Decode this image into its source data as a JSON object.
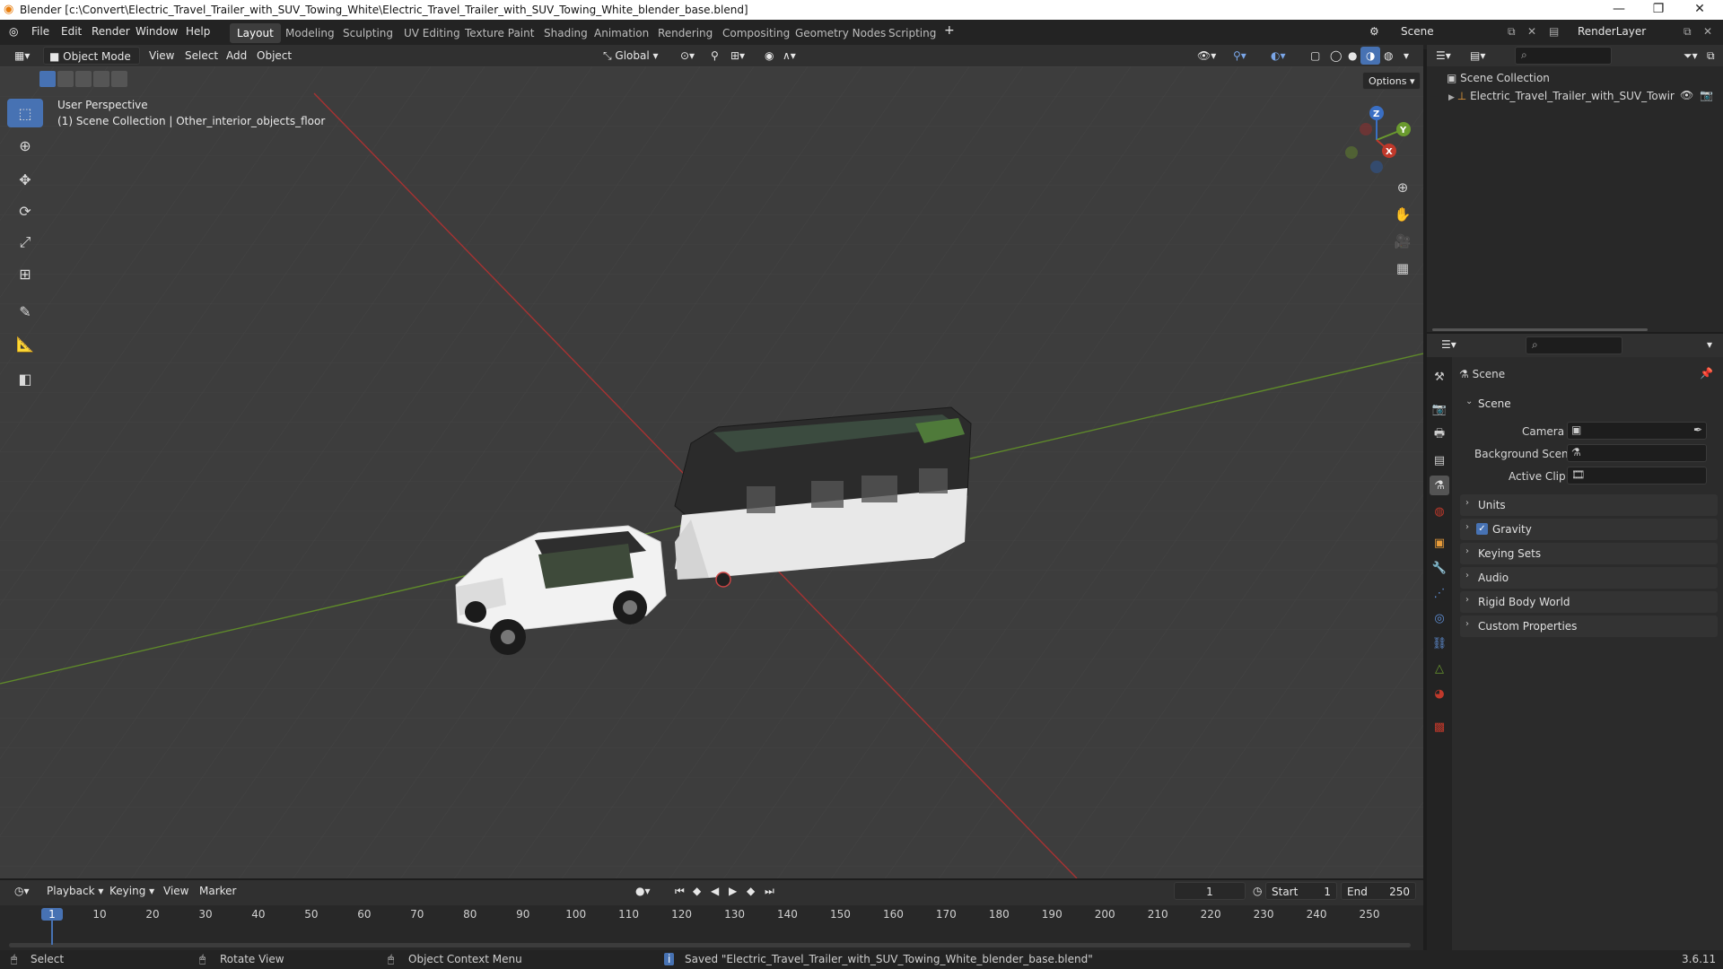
{
  "window": {
    "title": "Blender [c:\\Convert\\Electric_Travel_Trailer_with_SUV_Towing_White\\Electric_Travel_Trailer_with_SUV_Towing_White_blender_base.blend]",
    "minimize": "—",
    "maximize": "❐",
    "close": "✕"
  },
  "menu": {
    "file": "File",
    "edit": "Edit",
    "render": "Render",
    "window": "Window",
    "help": "Help"
  },
  "workspaces": [
    "Layout",
    "Modeling",
    "Sculpting",
    "UV Editing",
    "Texture Paint",
    "Shading",
    "Animation",
    "Rendering",
    "Compositing",
    "Geometry Nodes",
    "Scripting"
  ],
  "active_workspace": "Layout",
  "scene_selector": {
    "scene": "Scene",
    "render_layer": "RenderLayer"
  },
  "viewport_header": {
    "mode": "Object Mode",
    "view": "View",
    "select": "Select",
    "add": "Add",
    "object": "Object",
    "orientation": "Global",
    "options": "Options"
  },
  "viewport": {
    "perspective": "User Perspective",
    "collection_info": "(1) Scene Collection | Other_interior_objects_floor",
    "gizmo": {
      "x": "X",
      "y": "Y",
      "z": "Z"
    }
  },
  "outliner": {
    "root": "Scene Collection",
    "items": [
      {
        "label": "Electric_Travel_Trailer_with_SUV_Towir"
      }
    ]
  },
  "properties": {
    "header": "Scene",
    "section": "Scene",
    "camera_label": "Camera",
    "background_label": "Background Scene",
    "clip_label": "Active Clip",
    "panels": [
      "Units",
      "Gravity",
      "Keying Sets",
      "Audio",
      "Rigid Body World",
      "Custom Properties"
    ],
    "gravity_checked": true
  },
  "timeline": {
    "playback": "Playback",
    "keying": "Keying",
    "view": "View",
    "marker": "Marker",
    "current_frame": "1",
    "start_label": "Start",
    "start": "1",
    "end_label": "End",
    "end": "250",
    "ticks": [
      "1",
      "10",
      "20",
      "30",
      "40",
      "50",
      "60",
      "70",
      "80",
      "90",
      "100",
      "110",
      "120",
      "130",
      "140",
      "150",
      "160",
      "170",
      "180",
      "190",
      "200",
      "210",
      "220",
      "230",
      "240",
      "250"
    ]
  },
  "status": {
    "select": "Select",
    "rotate": "Rotate View",
    "context": "Object Context Menu",
    "message": "Saved \"Electric_Travel_Trailer_with_SUV_Towing_White_blender_base.blend\"",
    "version": "3.6.11"
  },
  "colors": {
    "accent": "#4772b3",
    "x_axis": "#c0392b",
    "y_axis": "#6a9a2e",
    "z_axis": "#3a6fc4"
  }
}
